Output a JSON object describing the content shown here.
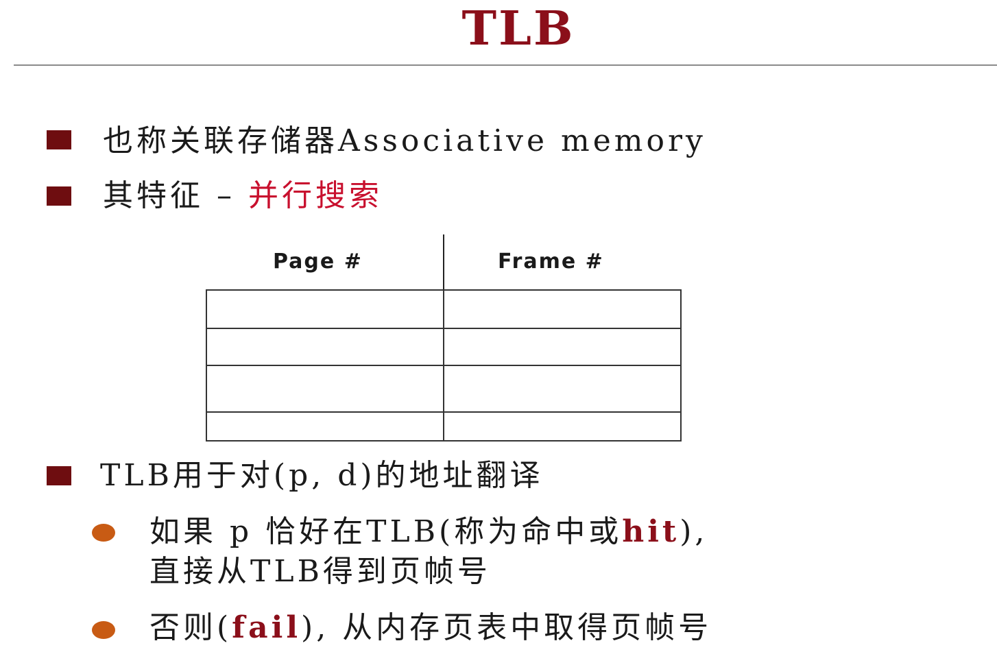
{
  "title": "TLB",
  "bullets": [
    {
      "text": "也称关联存储器Associative memory"
    },
    {
      "prefix": "其特征 – ",
      "highlight": "并行搜索"
    },
    {
      "text": "TLB用于对(p, d)的地址翻译"
    }
  ],
  "table": {
    "headers": [
      "Page #",
      "Frame #"
    ],
    "rows": [
      [
        "",
        ""
      ],
      [
        "",
        ""
      ],
      [
        "",
        ""
      ],
      [
        "",
        ""
      ]
    ]
  },
  "subbullets": [
    {
      "line1_prefix": "如果 p 恰好在TLB(称为命中或",
      "line1_highlight": "hit",
      "line1_suffix": "),",
      "line2": "直接从TLB得到页帧号"
    },
    {
      "prefix": "否则(",
      "highlight": "fail",
      "suffix": "), 从内存页表中取得页帧号"
    }
  ],
  "colors": {
    "title": "#8b0f1a",
    "square_bullet": "#6e0d10",
    "round_bullet": "#c85b14",
    "highlight_red": "#c8102e",
    "highlight_dark_red": "#8b0f1a"
  }
}
